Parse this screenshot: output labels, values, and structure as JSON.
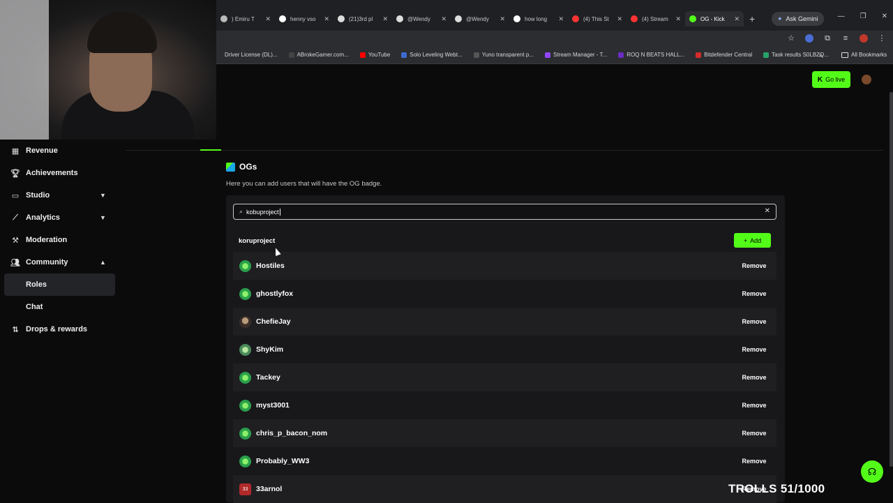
{
  "browser": {
    "tabs": [
      {
        "title": ") Emiru T",
        "icon_color": "#bbbbbb"
      },
      {
        "title": "henny vso",
        "icon_color": "#ffffff"
      },
      {
        "title": "(21)3rd pl",
        "icon_color": "#dddddd"
      },
      {
        "title": "@Wendy",
        "icon_color": "#dddddd"
      },
      {
        "title": "@Wendy",
        "icon_color": "#dddddd"
      },
      {
        "title": "how long",
        "icon_color": "#ffffff"
      },
      {
        "title": "(4) This St",
        "icon_color": "#ff3333"
      },
      {
        "title": "(4) Stream",
        "icon_color": "#ff3333"
      },
      {
        "title": "OG - Kick",
        "icon_color": "#53fc18",
        "active": true
      }
    ],
    "new_tab": "+",
    "ask_gemini": "Ask Gemini",
    "bookmarks": [
      {
        "label": "Driver License (DL)...",
        "color": "#2c2d31"
      },
      {
        "label": "ABrokeGamer.com...",
        "color": "#444444"
      },
      {
        "label": "YouTube",
        "color": "#ff0000"
      },
      {
        "label": "Solo Leveling Webt...",
        "color": "#3d6bd1"
      },
      {
        "label": "Yuno transparent p...",
        "color": "#555555"
      },
      {
        "label": "Stream Manager - T...",
        "color": "#9146ff"
      },
      {
        "label": "ROQ N BEATS HALL...",
        "color": "#6a2cc2"
      },
      {
        "label": "Bitdefender Central",
        "color": "#d62b2b"
      },
      {
        "label": "Task results S0LBZQ...",
        "color": "#26a269"
      }
    ],
    "bookmarks_more": "»",
    "all_bookmarks": "All Bookmarks"
  },
  "header": {
    "go_live": "Go live"
  },
  "sidebar": {
    "items": [
      {
        "label": "Revenue",
        "icon": "bar-chart-icon"
      },
      {
        "label": "Achievements",
        "icon": "trophy-icon"
      },
      {
        "label": "Studio",
        "icon": "monitor-icon",
        "chevron": "down"
      },
      {
        "label": "Analytics",
        "icon": "analytics-icon",
        "chevron": "down"
      },
      {
        "label": "Moderation",
        "icon": "hammer-icon"
      },
      {
        "label": "Community",
        "icon": "people-icon",
        "chevron": "up"
      }
    ],
    "community_sub": [
      "Roles",
      "Chat"
    ],
    "drops": {
      "label": "Drops & rewards",
      "icon": "gift-icon"
    }
  },
  "og_section": {
    "title": "OGs",
    "description": "Here you can add users that will have the OG badge.",
    "search_value": "kobuproject",
    "suggestion": "koruproject",
    "add_label": "Add",
    "remove_label": "Remove",
    "users": [
      {
        "name": "Hostiles",
        "avatar": "green"
      },
      {
        "name": "ghostlyfox",
        "avatar": "green"
      },
      {
        "name": "ChefieJay",
        "avatar": "photo"
      },
      {
        "name": "ShyKim",
        "avatar": "gray"
      },
      {
        "name": "Tackey",
        "avatar": "green"
      },
      {
        "name": "myst3001",
        "avatar": "green"
      },
      {
        "name": "chris_p_bacon_nom",
        "avatar": "green"
      },
      {
        "name": "Probably_WW3",
        "avatar": "green"
      },
      {
        "name": "33arnol",
        "avatar": "red",
        "avatar_text": "33"
      }
    ]
  },
  "overlay": {
    "trolls": "TROLLS 51/1000"
  },
  "colors": {
    "accent": "#53fc18",
    "background": "#0b0b0c",
    "panel": "#18181b"
  }
}
